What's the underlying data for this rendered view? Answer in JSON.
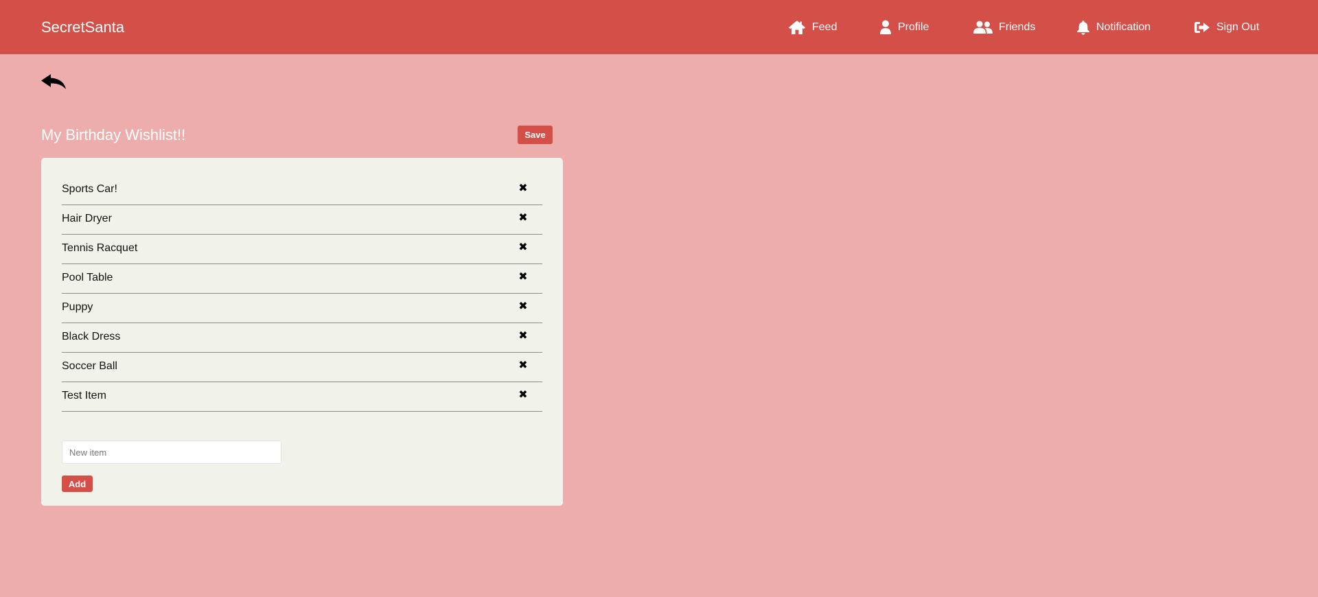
{
  "navbar": {
    "brand": "SecretSanta",
    "items": [
      {
        "label": "Feed",
        "icon": "home-icon"
      },
      {
        "label": "Profile",
        "icon": "user-icon"
      },
      {
        "label": "Friends",
        "icon": "users-icon"
      },
      {
        "label": "Notification",
        "icon": "bell-icon"
      },
      {
        "label": "Sign Out",
        "icon": "sign-out-icon"
      }
    ]
  },
  "back": {
    "icon": "back-arrow-icon"
  },
  "wishlist": {
    "title": "My Birthday Wishlist!!",
    "save_label": "Save",
    "items": [
      {
        "label": "Sports Car!",
        "remove_glyph": "✖"
      },
      {
        "label": "Hair Dryer",
        "remove_glyph": "✖"
      },
      {
        "label": "Tennis Racquet",
        "remove_glyph": "✖"
      },
      {
        "label": "Pool Table",
        "remove_glyph": "✖"
      },
      {
        "label": "Puppy",
        "remove_glyph": "✖"
      },
      {
        "label": "Black Dress",
        "remove_glyph": "✖"
      },
      {
        "label": "Soccer Ball",
        "remove_glyph": "✖"
      },
      {
        "label": "Test Item",
        "remove_glyph": "✖"
      }
    ],
    "new_item": {
      "value": "",
      "placeholder": "New item"
    },
    "add_label": "Add"
  },
  "colors": {
    "navbar": "#d44f47",
    "background": "#edadad",
    "card": "#f1f3ea",
    "button": "#d44f47"
  }
}
